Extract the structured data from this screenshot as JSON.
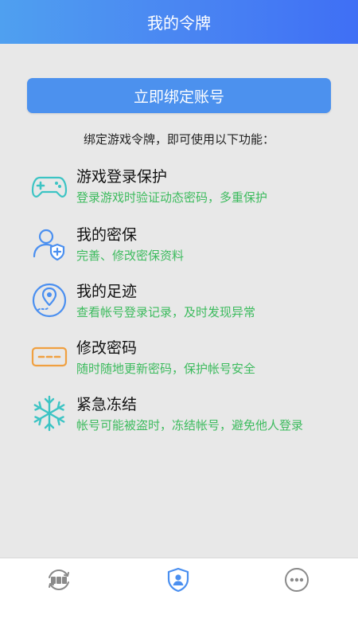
{
  "header": {
    "title": "我的令牌"
  },
  "bind_button": {
    "label": "立即绑定账号"
  },
  "intro_text": "绑定游戏令牌，即可使用以下功能：",
  "features": [
    {
      "icon": "gamepad-icon",
      "title": "游戏登录保护",
      "desc": "登录游戏时验证动态密码，多重保护"
    },
    {
      "icon": "user-shield-icon",
      "title": "我的密保",
      "desc": "完善、修改密保资料"
    },
    {
      "icon": "location-pin-icon",
      "title": "我的足迹",
      "desc": "查看帐号登录记录，及时发现异常"
    },
    {
      "icon": "password-icon",
      "title": "修改密码",
      "desc": "随时随地更新密码，保护帐号安全"
    },
    {
      "icon": "snowflake-icon",
      "title": "紧急冻结",
      "desc": "帐号可能被盗时，冻结帐号，避免他人登录"
    }
  ],
  "tabbar": {
    "items": [
      {
        "icon": "sync-icon",
        "active": false
      },
      {
        "icon": "shield-user-icon",
        "active": true
      },
      {
        "icon": "more-icon",
        "active": false
      }
    ]
  },
  "colors": {
    "header_gradient_start": "#4fa0f0",
    "header_gradient_end": "#3f6ff5",
    "button": "#4c91ee",
    "desc_green": "#3dbb5e",
    "tab_active": "#4a8ff0",
    "tab_inactive": "#8a8a8a"
  }
}
